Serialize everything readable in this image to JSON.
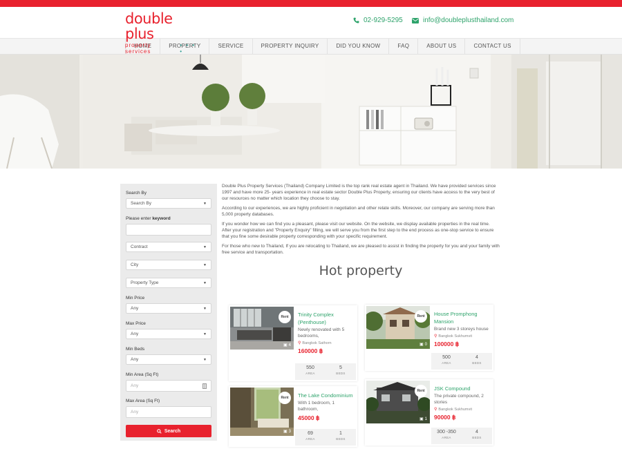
{
  "brand": {
    "name": "double plus",
    "tagline": "property services",
    "dots": "• • • •",
    "color": "#e8222e"
  },
  "contact": {
    "phone": "02-929-5295",
    "email": "info@doubleplusthailand.com"
  },
  "nav": [
    "HOME",
    "PROPERTY",
    "SERVICE",
    "PROPERTY INQUIRY",
    "DID YOU KNOW",
    "FAQ",
    "ABOUT US",
    "CONTACT US"
  ],
  "search": {
    "search_by_label": "Search By",
    "search_by_value": "Search By",
    "keyword_label_prefix": "Please enter",
    "keyword_label_bold": "keyword",
    "contract": "Contract",
    "city": "City",
    "property_type": "Property Type",
    "min_price_label": "Min Price",
    "min_price_value": "Any",
    "max_price_label": "Max Price",
    "max_price_value": "Any",
    "min_beds_label": "Min Beds",
    "min_beds_value": "Any",
    "min_area_label": "Min Area (Sq Ft)",
    "min_area_placeholder": "Any",
    "max_area_label": "Max Area (Sq Ft)",
    "max_area_placeholder": "Any",
    "button": "Search"
  },
  "intro": [
    "Double Plus Property Services (Thailand) Company Limited is the top rank real estate agent in Thailand.  We have provided services since 1997 and have more 25- years experience in real estate sector Double Plus Property, ensuring our clients have access to the very best of our resources no matter which location they choose to stay.",
    "According to our experiences, we are highly proficient in negotiation and other relate skills. Moreover, our company are serving more than 5,000 property databases.",
    "If you wonder how we can find you a pleasant, please visit our website. On the website, we display available properties in the real time. After your registration and \"Property Enquiry\" filling, we will serve you from the first step to the end process as one-stop service to ensure that you fine some desirable property corresponding with your specific requirement.",
    "For those who new to Thailand, If you are relocating to Thailand, we are pleased to assist in finding the property for you and your family with free service and transportation."
  ],
  "hot_title": "Hot property",
  "properties": [
    {
      "badge": "Rent",
      "images": "4",
      "title": "Trinity Complex (Penthouse)",
      "desc": "Newly renovated with 5 bedrooms,",
      "location": "Bangkok Sathorn",
      "price": "160000 ฿",
      "area": "550",
      "area_label": "AREA",
      "beds": "5",
      "beds_label": "BEDS"
    },
    {
      "badge": "Rent",
      "images": "0",
      "title": "House Promphong Mansion",
      "desc": "Brand new 3 storeys house",
      "location": "Bangkok Sukhumvit",
      "price": "100000 ฿",
      "area": "500",
      "area_label": "AREA",
      "beds": "4",
      "beds_label": "BEDS"
    },
    {
      "badge": "Rent",
      "images": "3",
      "title": "The Lake Condominium",
      "desc": "With 1 bedroom, 1 bathroom,",
      "location": "",
      "price": "45000 ฿",
      "area": "69",
      "area_label": "AREA",
      "beds": "1",
      "beds_label": "BEDS"
    },
    {
      "badge": "Rent",
      "images": "1",
      "title": "JSK Compound",
      "desc": "The private compound, 2 stories",
      "location": "Bangkok Sukhumvit",
      "price": "90000 ฿",
      "area": "300 -350",
      "area_label": "AREA",
      "beds": "4",
      "beds_label": "BEDS"
    }
  ]
}
